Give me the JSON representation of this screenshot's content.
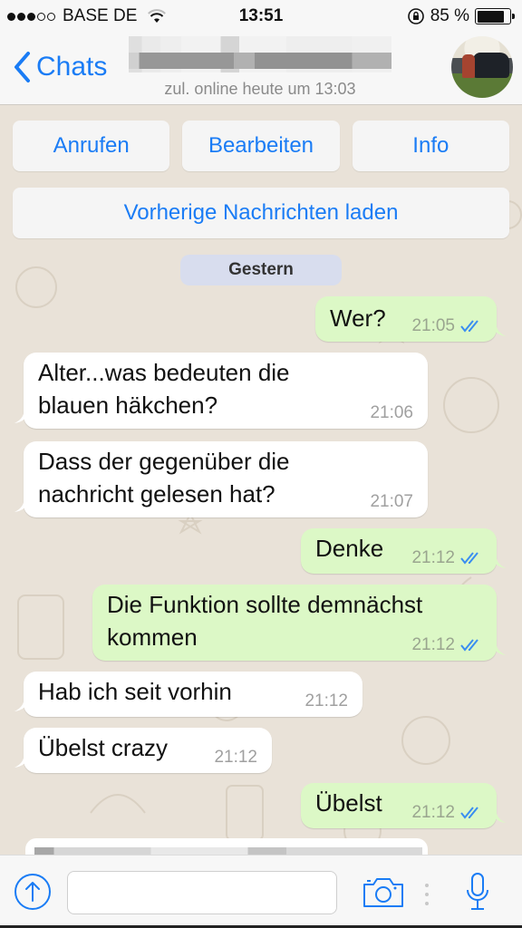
{
  "status_bar": {
    "signal_filled": 3,
    "signal_total": 5,
    "carrier": "BASE DE",
    "wifi_icon": "wifi-icon",
    "time": "13:51",
    "orientation_lock_icon": "orientation-lock-icon",
    "battery_percent_label": "85 %",
    "battery_level": 0.85
  },
  "nav": {
    "back_label": "Chats",
    "back_icon": "chevron-left-icon",
    "contact_name": "",
    "last_seen": "zul. online heute um 13:03",
    "avatar_icon": "contact-avatar"
  },
  "actions": {
    "call_label": "Anrufen",
    "edit_label": "Bearbeiten",
    "info_label": "Info",
    "load_earlier_label": "Vorherige Nachrichten laden"
  },
  "date_separator": "Gestern",
  "messages": [
    {
      "direction": "out",
      "text": "Wer?",
      "time": "21:05",
      "status": "read"
    },
    {
      "direction": "in",
      "text": "Alter...was bedeuten die blauen häkchen?",
      "time": "21:06"
    },
    {
      "direction": "in",
      "text": "Dass der gegenüber die nachricht gelesen hat?",
      "time": "21:07"
    },
    {
      "direction": "out",
      "text": "Denke",
      "time": "21:12",
      "status": "read"
    },
    {
      "direction": "out",
      "text": "Die Funktion sollte demnächst kommen",
      "time": "21:12",
      "status": "read"
    },
    {
      "direction": "in",
      "text": "Hab ich seit vorhin",
      "time": "21:12"
    },
    {
      "direction": "in",
      "text": "Übelst crazy",
      "time": "21:12"
    },
    {
      "direction": "out",
      "text": "Übelst",
      "time": "21:12",
      "status": "read"
    }
  ],
  "composer": {
    "input_value": "",
    "input_placeholder": "",
    "attach_icon": "upload-arrow-icon",
    "camera_icon": "camera-icon",
    "mic_icon": "microphone-icon"
  },
  "colors": {
    "accent": "#1a7cf5",
    "outgoing_bubble": "#dcf8c6",
    "incoming_bubble": "#ffffff",
    "read_ticks": "#3a8ef0",
    "date_badge": "#d8ddee"
  }
}
